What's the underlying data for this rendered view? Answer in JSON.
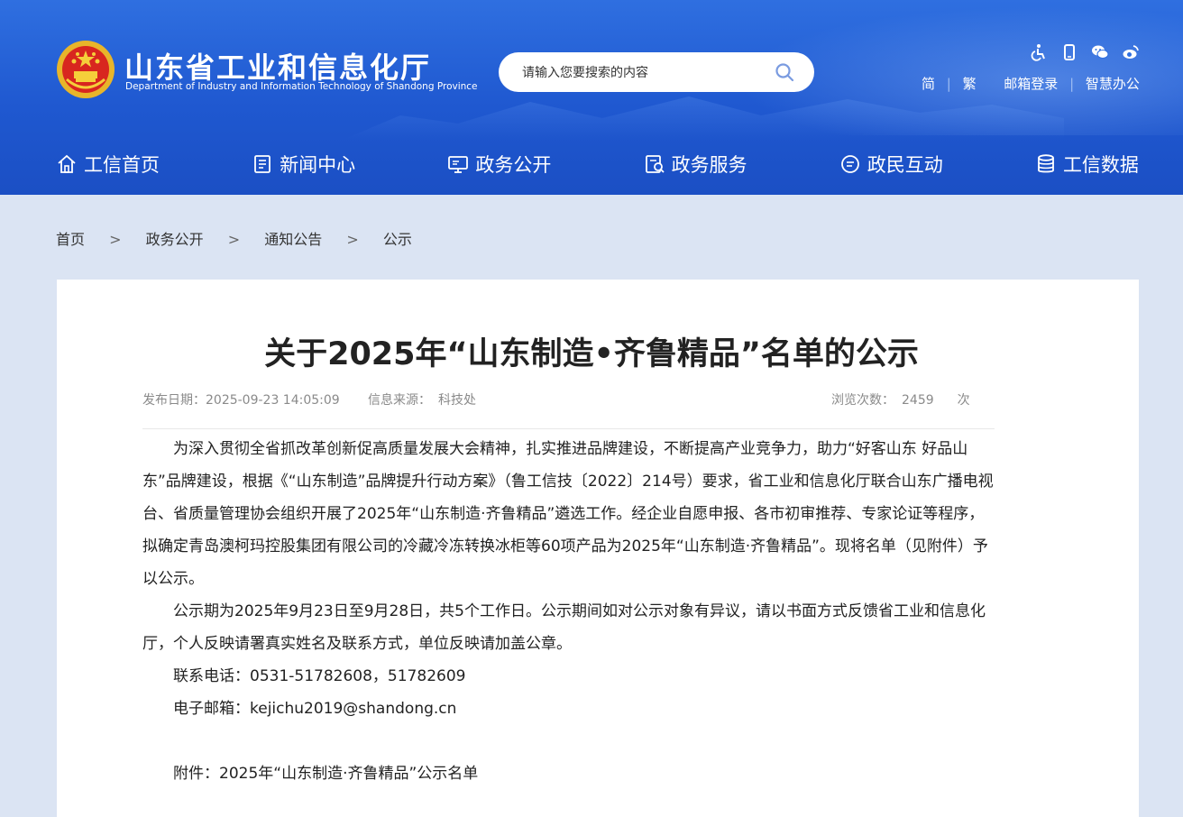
{
  "header": {
    "title": "山东省工业和信息化厅",
    "subtitle": "Department of Industry and Information Technology of Shandong Province",
    "search_placeholder": "请输入您要搜索的内容",
    "links": [
      "简",
      "繁",
      "邮箱登录",
      "智慧办公"
    ],
    "colors": {
      "primary": "#1f58d0",
      "accent": "#2f6fe0"
    }
  },
  "nav": {
    "items": [
      {
        "label": "工信首页",
        "icon": "home-icon"
      },
      {
        "label": "新闻中心",
        "icon": "news-icon"
      },
      {
        "label": "政务公开",
        "icon": "monitor-icon"
      },
      {
        "label": "政务服务",
        "icon": "service-icon"
      },
      {
        "label": "政民互动",
        "icon": "chat-icon"
      },
      {
        "label": "工信数据",
        "icon": "database-icon"
      }
    ]
  },
  "breadcrumb": {
    "items": [
      "首页",
      "政务公开",
      "通知公告",
      "公示"
    ],
    "separator": ">"
  },
  "article": {
    "title": "关于2025年“山东制造•齐鲁精品”名单的公示",
    "meta": {
      "date_label": "发布日期：",
      "date_value": "2025-09-23 14:05:09",
      "source_label": "信息来源：",
      "source_value": "科技处",
      "views_label": "浏览次数：",
      "views_value": "2459",
      "views_unit": "次"
    },
    "paragraphs": [
      "为深入贯彻全省抓改革创新促高质量发展大会精神，扎实推进品牌建设，不断提高产业竞争力，助力“好客山东 好品山东”品牌建设，根据《“山东制造”品牌提升行动方案》（鲁工信技〔2022〕214号）要求，省工业和信息化厅联合山东广播电视台、省质量管理协会组织开展了2025年“山东制造·齐鲁精品”遴选工作。经企业自愿申报、各市初审推荐、专家论证等程序，拟确定青岛澳柯玛控股集团有限公司的冷藏冷冻转换冰柜等60项产品为2025年“山东制造·齐鲁精品”。现将名单（见附件）予以公示。",
      "公示期为2025年9月23日至9月28日，共5个工作日。公示期间如对公示对象有异议，请以书面方式反馈省工业和信息化厅，个人反映请署真实姓名及联系方式，单位反映请加盖公章。",
      "联系电话：0531-51782608，51782609",
      "电子邮箱：kejichu2019@shandong.cn"
    ],
    "attachment": "附件：2025年“山东制造·齐鲁精品”公示名单"
  }
}
